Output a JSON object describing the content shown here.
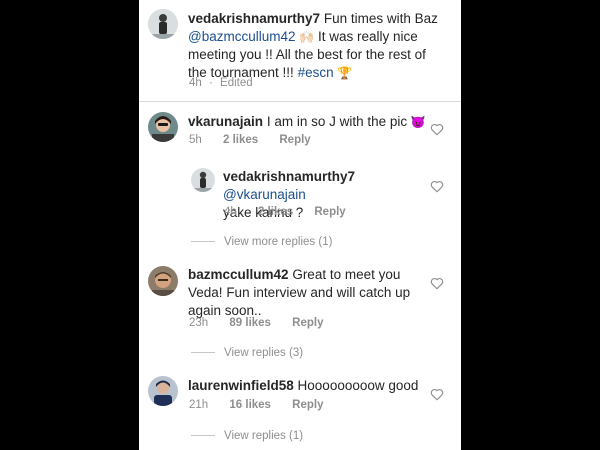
{
  "caption": {
    "username": "vedakrishnamurthy7",
    "text_1": "Fun times with Baz",
    "mention": "@bazmccullum42",
    "emoji_1": "🙌🏻",
    "text_2": "It was really nice meeting you !! All the best for the rest of the tournament !!!",
    "hashtag": "#escn",
    "emoji_2": "🏆",
    "time": "4h",
    "edited": "Edited"
  },
  "comments": [
    {
      "username": "vkarunajain",
      "text": "I am in so J with the pic",
      "emoji": "😈",
      "time": "5h",
      "likes": "2 likes",
      "reply": "Reply"
    },
    {
      "username": "vedakrishnamurthy7",
      "mention": "@vkarunajain",
      "text": "yake kannu ?",
      "time": "4h",
      "likes": "2 likes",
      "reply": "Reply",
      "view_more": "View more replies (1)"
    },
    {
      "username": "bazmccullum42",
      "text_1": "Great to meet you Veda!",
      "text_2": "Fun interview and will catch up again soon..",
      "time": "23h",
      "likes": "89 likes",
      "reply": "Reply",
      "view_replies": "View replies (3)"
    },
    {
      "username": "laurenwinfield58",
      "text": "Hooooooooow good",
      "time": "21h",
      "likes": "16 likes",
      "reply": "Reply",
      "view_replies": "View replies (1)"
    }
  ],
  "colors": {
    "background": "#000000",
    "panel": "#ffffff",
    "text": "#262626",
    "muted": "#8e8e8e",
    "link": "#1c4f8c"
  },
  "icons": {
    "heart": "heart-outline-icon"
  }
}
